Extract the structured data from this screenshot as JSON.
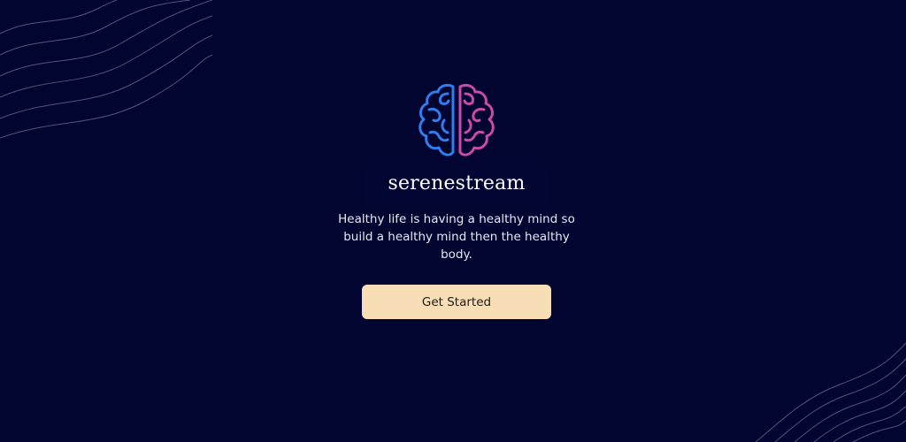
{
  "brand": {
    "name": "serenestream",
    "logo_icon": "brain-icon"
  },
  "hero": {
    "tagline": "Healthy life is having a healthy mind so build a healthy mind then the healthy body.",
    "cta_label": "Get Started"
  },
  "colors": {
    "background": "#02052f",
    "cta_background": "#f8deb6",
    "logo_left": "#2f7df0",
    "logo_right": "#c94aa8",
    "decor_lines": "#6c6f8f"
  }
}
